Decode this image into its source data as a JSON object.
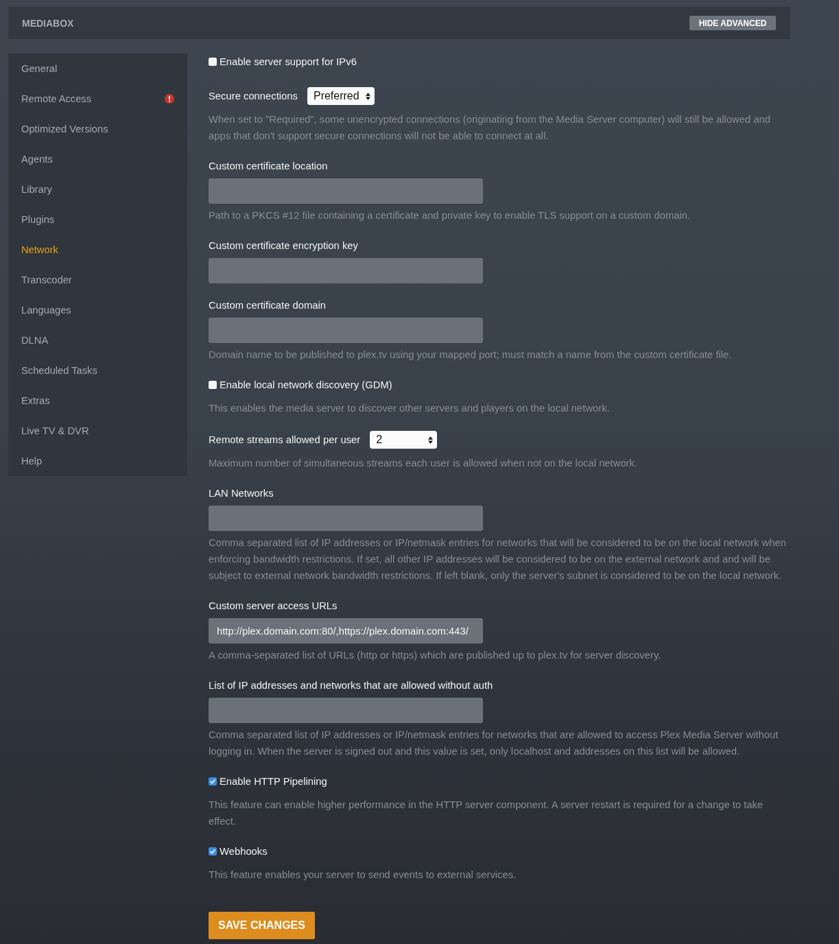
{
  "header": {
    "title": "MEDIABOX",
    "button": "HIDE ADVANCED"
  },
  "sidebar": {
    "items": [
      {
        "label": "General",
        "selected": false,
        "alert": false
      },
      {
        "label": "Remote Access",
        "selected": false,
        "alert": true
      },
      {
        "label": "Optimized Versions",
        "selected": false,
        "alert": false
      },
      {
        "label": "Agents",
        "selected": false,
        "alert": false
      },
      {
        "label": "Library",
        "selected": false,
        "alert": false
      },
      {
        "label": "Plugins",
        "selected": false,
        "alert": false
      },
      {
        "label": "Network",
        "selected": true,
        "alert": false
      },
      {
        "label": "Transcoder",
        "selected": false,
        "alert": false
      },
      {
        "label": "Languages",
        "selected": false,
        "alert": false
      },
      {
        "label": "DLNA",
        "selected": false,
        "alert": false
      },
      {
        "label": "Scheduled Tasks",
        "selected": false,
        "alert": false
      },
      {
        "label": "Extras",
        "selected": false,
        "alert": false
      },
      {
        "label": "Live TV & DVR",
        "selected": false,
        "alert": false
      },
      {
        "label": "Help",
        "selected": false,
        "alert": false
      }
    ]
  },
  "settings": [
    {
      "kind": "checkbox",
      "label": "Enable server support for IPv6",
      "checked": false
    },
    {
      "kind": "select",
      "label": "Secure connections",
      "value": "Preferred",
      "help": "When set to \"Required\", some unencrypted connections (originating from the Media Server computer) will still be allowed and apps that don't support secure connections will not be able to connect at all."
    },
    {
      "kind": "text",
      "label": "Custom certificate location",
      "help": "Path to a PKCS #12 file containing a certificate and private key to enable TLS support on a custom domain."
    },
    {
      "kind": "text",
      "label": "Custom certificate encryption key"
    },
    {
      "kind": "text",
      "label": "Custom certificate domain",
      "help": "Domain name to be published to plex.tv using your mapped port; must match a name from the custom certificate file."
    },
    {
      "kind": "checkbox",
      "label": "Enable local network discovery (GDM)",
      "checked": false,
      "help": "This enables the media server to discover other servers and players on the local network."
    },
    {
      "kind": "select",
      "label": "Remote streams allowed per user",
      "value": "2",
      "help": "Maximum number of simultaneous streams each user is allowed when not on the local network."
    },
    {
      "kind": "text",
      "label": "LAN Networks",
      "help": "Comma separated list of IP addresses or IP/netmask entries for networks that will be considered to be on the local network when enforcing bandwidth restrictions. If set, all other IP addresses will be considered to be on the external network and and will be subject to external network bandwidth restrictions. If left blank, only the server's subnet is considered to be on the local network."
    },
    {
      "kind": "text",
      "label": "Custom server access URLs",
      "value": "http://plex.domain.com:80/,https://plex.domain.com:443/",
      "help": "A comma-separated list of URLs (http or https) which are published up to plex.tv for server discovery."
    },
    {
      "kind": "text",
      "label": "List of IP addresses and networks that are allowed without auth",
      "help": "Comma separated list of IP addresses or IP/netmask entries for networks that are allowed to access Plex Media Server without logging in. When the server is signed out and this value is set, only localhost and addresses on this list will be allowed."
    },
    {
      "kind": "checkbox",
      "label": "Enable HTTP Pipelining",
      "checked": true,
      "help": "This feature can enable higher performance in the HTTP server component. A server restart is required for a change to take effect."
    },
    {
      "kind": "checkbox",
      "label": "Webhooks",
      "checked": true,
      "help": "This feature enables your server to send events to external services."
    }
  ],
  "save_button": "SAVE CHANGES"
}
